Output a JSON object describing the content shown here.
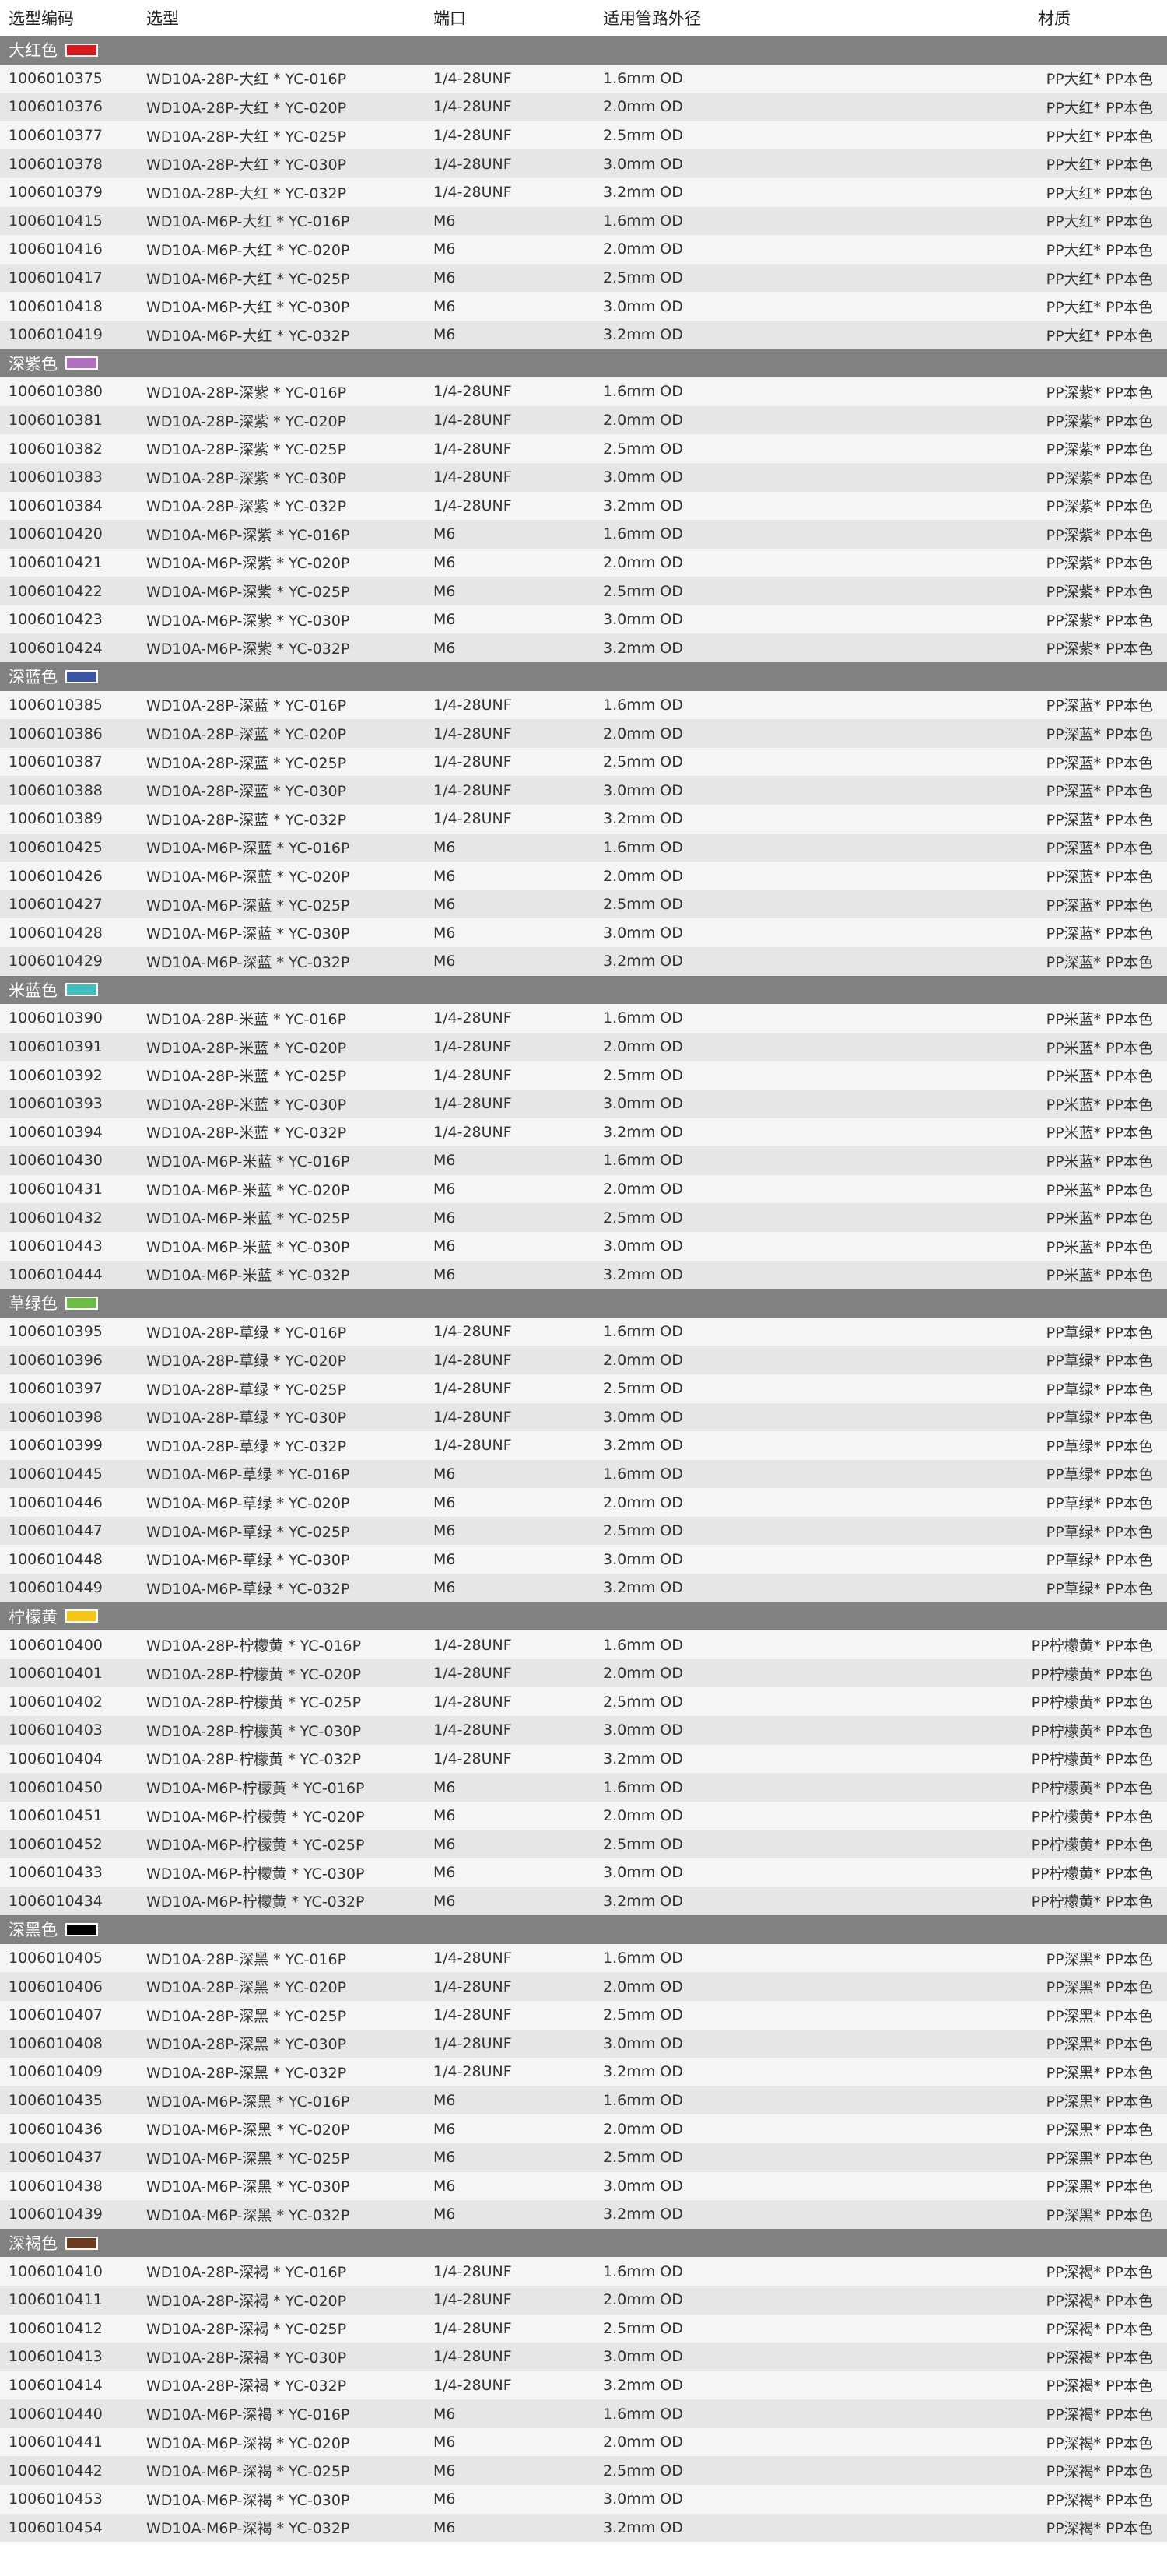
{
  "header": {
    "code": "选型编码",
    "model": "选型",
    "port": "端口",
    "tube_od": "适用管路外径",
    "material": "材质"
  },
  "groups": [
    {
      "name": "大红色",
      "color": "#d71920",
      "rows": [
        [
          "1006010375",
          "WD10A-28P-大红 * YC-016P",
          "1/4-28UNF",
          "1.6mm OD",
          "PP大红* PP本色"
        ],
        [
          "1006010376",
          "WD10A-28P-大红 * YC-020P",
          "1/4-28UNF",
          "2.0mm OD",
          "PP大红* PP本色"
        ],
        [
          "1006010377",
          "WD10A-28P-大红 * YC-025P",
          "1/4-28UNF",
          "2.5mm OD",
          "PP大红* PP本色"
        ],
        [
          "1006010378",
          "WD10A-28P-大红 * YC-030P",
          "1/4-28UNF",
          "3.0mm OD",
          "PP大红* PP本色"
        ],
        [
          "1006010379",
          "WD10A-28P-大红 * YC-032P",
          "1/4-28UNF",
          "3.2mm OD",
          "PP大红* PP本色"
        ],
        [
          "1006010415",
          "WD10A-M6P-大红 * YC-016P",
          "M6",
          "1.6mm OD",
          "PP大红* PP本色"
        ],
        [
          "1006010416",
          "WD10A-M6P-大红 * YC-020P",
          "M6",
          "2.0mm OD",
          "PP大红* PP本色"
        ],
        [
          "1006010417",
          "WD10A-M6P-大红 * YC-025P",
          "M6",
          "2.5mm OD",
          "PP大红* PP本色"
        ],
        [
          "1006010418",
          "WD10A-M6P-大红 * YC-030P",
          "M6",
          "3.0mm OD",
          "PP大红* PP本色"
        ],
        [
          "1006010419",
          "WD10A-M6P-大红 * YC-032P",
          "M6",
          "3.2mm OD",
          "PP大红* PP本色"
        ]
      ]
    },
    {
      "name": "深紫色",
      "color": "#b06fc0",
      "rows": [
        [
          "1006010380",
          "WD10A-28P-深紫 * YC-016P",
          "1/4-28UNF",
          "1.6mm OD",
          "PP深紫* PP本色"
        ],
        [
          "1006010381",
          "WD10A-28P-深紫 * YC-020P",
          "1/4-28UNF",
          "2.0mm OD",
          "PP深紫* PP本色"
        ],
        [
          "1006010382",
          "WD10A-28P-深紫 * YC-025P",
          "1/4-28UNF",
          "2.5mm OD",
          "PP深紫* PP本色"
        ],
        [
          "1006010383",
          "WD10A-28P-深紫 * YC-030P",
          "1/4-28UNF",
          "3.0mm OD",
          "PP深紫* PP本色"
        ],
        [
          "1006010384",
          "WD10A-28P-深紫 * YC-032P",
          "1/4-28UNF",
          "3.2mm OD",
          "PP深紫* PP本色"
        ],
        [
          "1006010420",
          "WD10A-M6P-深紫 * YC-016P",
          "M6",
          "1.6mm OD",
          "PP深紫* PP本色"
        ],
        [
          "1006010421",
          "WD10A-M6P-深紫 * YC-020P",
          "M6",
          "2.0mm OD",
          "PP深紫* PP本色"
        ],
        [
          "1006010422",
          "WD10A-M6P-深紫 * YC-025P",
          "M6",
          "2.5mm OD",
          "PP深紫* PP本色"
        ],
        [
          "1006010423",
          "WD10A-M6P-深紫 * YC-030P",
          "M6",
          "3.0mm OD",
          "PP深紫* PP本色"
        ],
        [
          "1006010424",
          "WD10A-M6P-深紫 * YC-032P",
          "M6",
          "3.2mm OD",
          "PP深紫* PP本色"
        ]
      ]
    },
    {
      "name": "深蓝色",
      "color": "#3a55a4",
      "rows": [
        [
          "1006010385",
          "WD10A-28P-深蓝 * YC-016P",
          "1/4-28UNF",
          "1.6mm OD",
          "PP深蓝* PP本色"
        ],
        [
          "1006010386",
          "WD10A-28P-深蓝 * YC-020P",
          "1/4-28UNF",
          "2.0mm OD",
          "PP深蓝* PP本色"
        ],
        [
          "1006010387",
          "WD10A-28P-深蓝 * YC-025P",
          "1/4-28UNF",
          "2.5mm OD",
          "PP深蓝* PP本色"
        ],
        [
          "1006010388",
          "WD10A-28P-深蓝 * YC-030P",
          "1/4-28UNF",
          "3.0mm OD",
          "PP深蓝* PP本色"
        ],
        [
          "1006010389",
          "WD10A-28P-深蓝 * YC-032P",
          "1/4-28UNF",
          "3.2mm OD",
          "PP深蓝* PP本色"
        ],
        [
          "1006010425",
          "WD10A-M6P-深蓝 * YC-016P",
          "M6",
          "1.6mm OD",
          "PP深蓝* PP本色"
        ],
        [
          "1006010426",
          "WD10A-M6P-深蓝 * YC-020P",
          "M6",
          "2.0mm OD",
          "PP深蓝* PP本色"
        ],
        [
          "1006010427",
          "WD10A-M6P-深蓝 * YC-025P",
          "M6",
          "2.5mm OD",
          "PP深蓝* PP本色"
        ],
        [
          "1006010428",
          "WD10A-M6P-深蓝 * YC-030P",
          "M6",
          "3.0mm OD",
          "PP深蓝* PP本色"
        ],
        [
          "1006010429",
          "WD10A-M6P-深蓝 * YC-032P",
          "M6",
          "3.2mm OD",
          "PP深蓝* PP本色"
        ]
      ]
    },
    {
      "name": "米蓝色",
      "color": "#3fbfbf",
      "rows": [
        [
          "1006010390",
          "WD10A-28P-米蓝 * YC-016P",
          "1/4-28UNF",
          "1.6mm OD",
          "PP米蓝* PP本色"
        ],
        [
          "1006010391",
          "WD10A-28P-米蓝 * YC-020P",
          "1/4-28UNF",
          "2.0mm OD",
          "PP米蓝* PP本色"
        ],
        [
          "1006010392",
          "WD10A-28P-米蓝 * YC-025P",
          "1/4-28UNF",
          "2.5mm OD",
          "PP米蓝* PP本色"
        ],
        [
          "1006010393",
          "WD10A-28P-米蓝 * YC-030P",
          "1/4-28UNF",
          "3.0mm OD",
          "PP米蓝* PP本色"
        ],
        [
          "1006010394",
          "WD10A-28P-米蓝 * YC-032P",
          "1/4-28UNF",
          "3.2mm OD",
          "PP米蓝* PP本色"
        ],
        [
          "1006010430",
          "WD10A-M6P-米蓝 * YC-016P",
          "M6",
          "1.6mm OD",
          "PP米蓝* PP本色"
        ],
        [
          "1006010431",
          "WD10A-M6P-米蓝 * YC-020P",
          "M6",
          "2.0mm OD",
          "PP米蓝* PP本色"
        ],
        [
          "1006010432",
          "WD10A-M6P-米蓝 * YC-025P",
          "M6",
          "2.5mm OD",
          "PP米蓝* PP本色"
        ],
        [
          "1006010443",
          "WD10A-M6P-米蓝 * YC-030P",
          "M6",
          "3.0mm OD",
          "PP米蓝* PP本色"
        ],
        [
          "1006010444",
          "WD10A-M6P-米蓝 * YC-032P",
          "M6",
          "3.2mm OD",
          "PP米蓝* PP本色"
        ]
      ]
    },
    {
      "name": "草绿色",
      "color": "#6cbd45",
      "rows": [
        [
          "1006010395",
          "WD10A-28P-草绿 * YC-016P",
          "1/4-28UNF",
          "1.6mm OD",
          "PP草绿* PP本色"
        ],
        [
          "1006010396",
          "WD10A-28P-草绿 * YC-020P",
          "1/4-28UNF",
          "2.0mm OD",
          "PP草绿* PP本色"
        ],
        [
          "1006010397",
          "WD10A-28P-草绿 * YC-025P",
          "1/4-28UNF",
          "2.5mm OD",
          "PP草绿* PP本色"
        ],
        [
          "1006010398",
          "WD10A-28P-草绿 * YC-030P",
          "1/4-28UNF",
          "3.0mm OD",
          "PP草绿* PP本色"
        ],
        [
          "1006010399",
          "WD10A-28P-草绿 * YC-032P",
          "1/4-28UNF",
          "3.2mm OD",
          "PP草绿* PP本色"
        ],
        [
          "1006010445",
          "WD10A-M6P-草绿 * YC-016P",
          "M6",
          "1.6mm OD",
          "PP草绿* PP本色"
        ],
        [
          "1006010446",
          "WD10A-M6P-草绿 * YC-020P",
          "M6",
          "2.0mm OD",
          "PP草绿* PP本色"
        ],
        [
          "1006010447",
          "WD10A-M6P-草绿 * YC-025P",
          "M6",
          "2.5mm OD",
          "PP草绿* PP本色"
        ],
        [
          "1006010448",
          "WD10A-M6P-草绿 * YC-030P",
          "M6",
          "3.0mm OD",
          "PP草绿* PP本色"
        ],
        [
          "1006010449",
          "WD10A-M6P-草绿 * YC-032P",
          "M6",
          "3.2mm OD",
          "PP草绿* PP本色"
        ]
      ]
    },
    {
      "name": "柠檬黄",
      "color": "#f5c518",
      "rows": [
        [
          "1006010400",
          "WD10A-28P-柠檬黄 * YC-016P",
          "1/4-28UNF",
          "1.6mm OD",
          "PP柠檬黄* PP本色"
        ],
        [
          "1006010401",
          "WD10A-28P-柠檬黄 * YC-020P",
          "1/4-28UNF",
          "2.0mm OD",
          "PP柠檬黄* PP本色"
        ],
        [
          "1006010402",
          "WD10A-28P-柠檬黄 * YC-025P",
          "1/4-28UNF",
          "2.5mm OD",
          "PP柠檬黄* PP本色"
        ],
        [
          "1006010403",
          "WD10A-28P-柠檬黄 * YC-030P",
          "1/4-28UNF",
          "3.0mm OD",
          "PP柠檬黄* PP本色"
        ],
        [
          "1006010404",
          "WD10A-28P-柠檬黄 * YC-032P",
          "1/4-28UNF",
          "3.2mm OD",
          "PP柠檬黄* PP本色"
        ],
        [
          "1006010450",
          "WD10A-M6P-柠檬黄 * YC-016P",
          "M6",
          "1.6mm OD",
          "PP柠檬黄* PP本色"
        ],
        [
          "1006010451",
          "WD10A-M6P-柠檬黄 * YC-020P",
          "M6",
          "2.0mm OD",
          "PP柠檬黄* PP本色"
        ],
        [
          "1006010452",
          "WD10A-M6P-柠檬黄 * YC-025P",
          "M6",
          "2.5mm OD",
          "PP柠檬黄* PP本色"
        ],
        [
          "1006010433",
          "WD10A-M6P-柠檬黄 * YC-030P",
          "M6",
          "3.0mm OD",
          "PP柠檬黄* PP本色"
        ],
        [
          "1006010434",
          "WD10A-M6P-柠檬黄 * YC-032P",
          "M6",
          "3.2mm OD",
          "PP柠檬黄* PP本色"
        ]
      ]
    },
    {
      "name": "深黑色",
      "color": "#000000",
      "rows": [
        [
          "1006010405",
          "WD10A-28P-深黑 * YC-016P",
          "1/4-28UNF",
          "1.6mm OD",
          "PP深黑* PP本色"
        ],
        [
          "1006010406",
          "WD10A-28P-深黑 * YC-020P",
          "1/4-28UNF",
          "2.0mm OD",
          "PP深黑* PP本色"
        ],
        [
          "1006010407",
          "WD10A-28P-深黑 * YC-025P",
          "1/4-28UNF",
          "2.5mm OD",
          "PP深黑* PP本色"
        ],
        [
          "1006010408",
          "WD10A-28P-深黑 * YC-030P",
          "1/4-28UNF",
          "3.0mm OD",
          "PP深黑* PP本色"
        ],
        [
          "1006010409",
          "WD10A-28P-深黑 * YC-032P",
          "1/4-28UNF",
          "3.2mm OD",
          "PP深黑* PP本色"
        ],
        [
          "1006010435",
          "WD10A-M6P-深黑 * YC-016P",
          "M6",
          "1.6mm OD",
          "PP深黑* PP本色"
        ],
        [
          "1006010436",
          "WD10A-M6P-深黑 * YC-020P",
          "M6",
          "2.0mm OD",
          "PP深黑* PP本色"
        ],
        [
          "1006010437",
          "WD10A-M6P-深黑 * YC-025P",
          "M6",
          "2.5mm OD",
          "PP深黑* PP本色"
        ],
        [
          "1006010438",
          "WD10A-M6P-深黑 * YC-030P",
          "M6",
          "3.0mm OD",
          "PP深黑* PP本色"
        ],
        [
          "1006010439",
          "WD10A-M6P-深黑 * YC-032P",
          "M6",
          "3.2mm OD",
          "PP深黑* PP本色"
        ]
      ]
    },
    {
      "name": "深褐色",
      "color": "#6b3a1f",
      "rows": [
        [
          "1006010410",
          "WD10A-28P-深褐 * YC-016P",
          "1/4-28UNF",
          "1.6mm OD",
          "PP深褐* PP本色"
        ],
        [
          "1006010411",
          "WD10A-28P-深褐 * YC-020P",
          "1/4-28UNF",
          "2.0mm OD",
          "PP深褐* PP本色"
        ],
        [
          "1006010412",
          "WD10A-28P-深褐 * YC-025P",
          "1/4-28UNF",
          "2.5mm OD",
          "PP深褐* PP本色"
        ],
        [
          "1006010413",
          "WD10A-28P-深褐 * YC-030P",
          "1/4-28UNF",
          "3.0mm OD",
          "PP深褐* PP本色"
        ],
        [
          "1006010414",
          "WD10A-28P-深褐 * YC-032P",
          "1/4-28UNF",
          "3.2mm OD",
          "PP深褐* PP本色"
        ],
        [
          "1006010440",
          "WD10A-M6P-深褐 * YC-016P",
          "M6",
          "1.6mm OD",
          "PP深褐* PP本色"
        ],
        [
          "1006010441",
          "WD10A-M6P-深褐 * YC-020P",
          "M6",
          "2.0mm OD",
          "PP深褐* PP本色"
        ],
        [
          "1006010442",
          "WD10A-M6P-深褐 * YC-025P",
          "M6",
          "2.5mm OD",
          "PP深褐* PP本色"
        ],
        [
          "1006010453",
          "WD10A-M6P-深褐 * YC-030P",
          "M6",
          "3.0mm OD",
          "PP深褐* PP本色"
        ],
        [
          "1006010454",
          "WD10A-M6P-深褐 * YC-032P",
          "M6",
          "3.2mm OD",
          "PP深褐* PP本色"
        ]
      ]
    }
  ]
}
